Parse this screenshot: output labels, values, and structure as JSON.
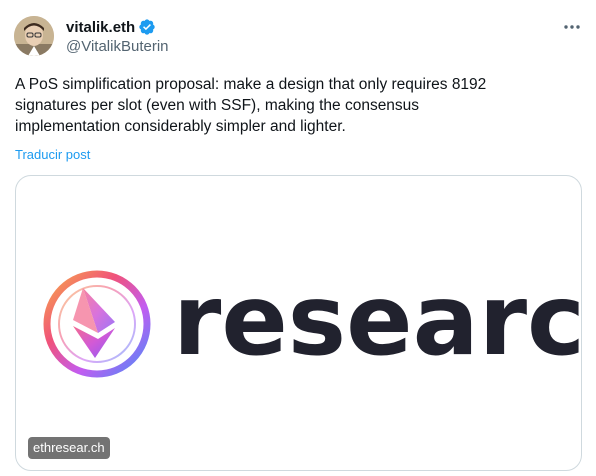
{
  "author": {
    "display_name": "vitalik.eth",
    "handle": "@VitalikButerin",
    "verified": true
  },
  "icons": {
    "verified": "verified-badge-icon",
    "more": "more-options-icon",
    "logo": "ethresearch-logo-icon"
  },
  "tweet": {
    "text": "A PoS simplification proposal: make a design that only requires 8192\nsignatures per slot (even with SSF), making the consensus\nimplementation considerably simpler and lighter.",
    "translate_label": "Traducir post"
  },
  "card": {
    "headline_word": "research",
    "domain": "ethresear.ch"
  },
  "colors": {
    "accent": "#1d9bf0",
    "text": "#0f1419",
    "secondary": "#536471",
    "border": "#cfd9de",
    "logo_text": "#21222e"
  }
}
